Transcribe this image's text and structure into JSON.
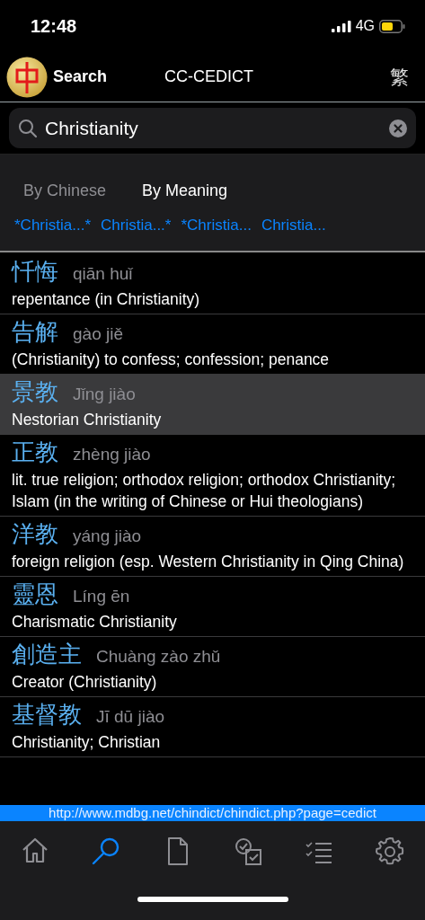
{
  "status_bar": {
    "time": "12:48",
    "network": "4G"
  },
  "header": {
    "title": "Search",
    "dictionary": "CC-CEDICT",
    "script_toggle": "繁"
  },
  "search": {
    "value": "Christianity"
  },
  "modes": [
    {
      "label": "By Chinese",
      "selected": false
    },
    {
      "label": "By Meaning",
      "selected": true
    }
  ],
  "patterns": [
    "*Christia...*",
    "Christia...*",
    "*Christia...",
    "Christia..."
  ],
  "results": [
    {
      "hanzi": "忏悔",
      "pinyin": "qiān huǐ",
      "definition": "repentance (in Christianity)",
      "selected": false
    },
    {
      "hanzi": "告解",
      "pinyin": "gào jiě",
      "definition": "(Christianity) to confess; confession; penance",
      "selected": false
    },
    {
      "hanzi": "景教",
      "pinyin": "Jǐng jiào",
      "definition": "Nestorian Christianity",
      "selected": true
    },
    {
      "hanzi": "正教",
      "pinyin": "zhèng jiào",
      "definition": "lit. true religion; orthodox religion; orthodox Christianity; Islam (in the writing of Chinese or Hui theologians)",
      "selected": false
    },
    {
      "hanzi": "洋教",
      "pinyin": "yáng jiào",
      "definition": "foreign religion (esp. Western Christianity in Qing China)",
      "selected": false
    },
    {
      "hanzi": "靈恩",
      "pinyin": "Líng ēn",
      "definition": "Charismatic Christianity",
      "selected": false
    },
    {
      "hanzi": "創造主",
      "pinyin": "Chuàng zào zhǔ",
      "definition": "Creator (Christianity)",
      "selected": false
    },
    {
      "hanzi": "基督教",
      "pinyin": "Jī dū jiào",
      "definition": "Christianity; Christian",
      "selected": false
    }
  ],
  "source_url": "http://www.mdbg.net/chindict/chindict.php?page=cedict",
  "tab_bar": [
    {
      "kind": "home",
      "selected": false
    },
    {
      "kind": "search",
      "selected": true
    },
    {
      "kind": "document",
      "selected": false
    },
    {
      "kind": "quiz",
      "selected": false
    },
    {
      "kind": "list",
      "selected": false
    },
    {
      "kind": "settings",
      "selected": false
    }
  ]
}
